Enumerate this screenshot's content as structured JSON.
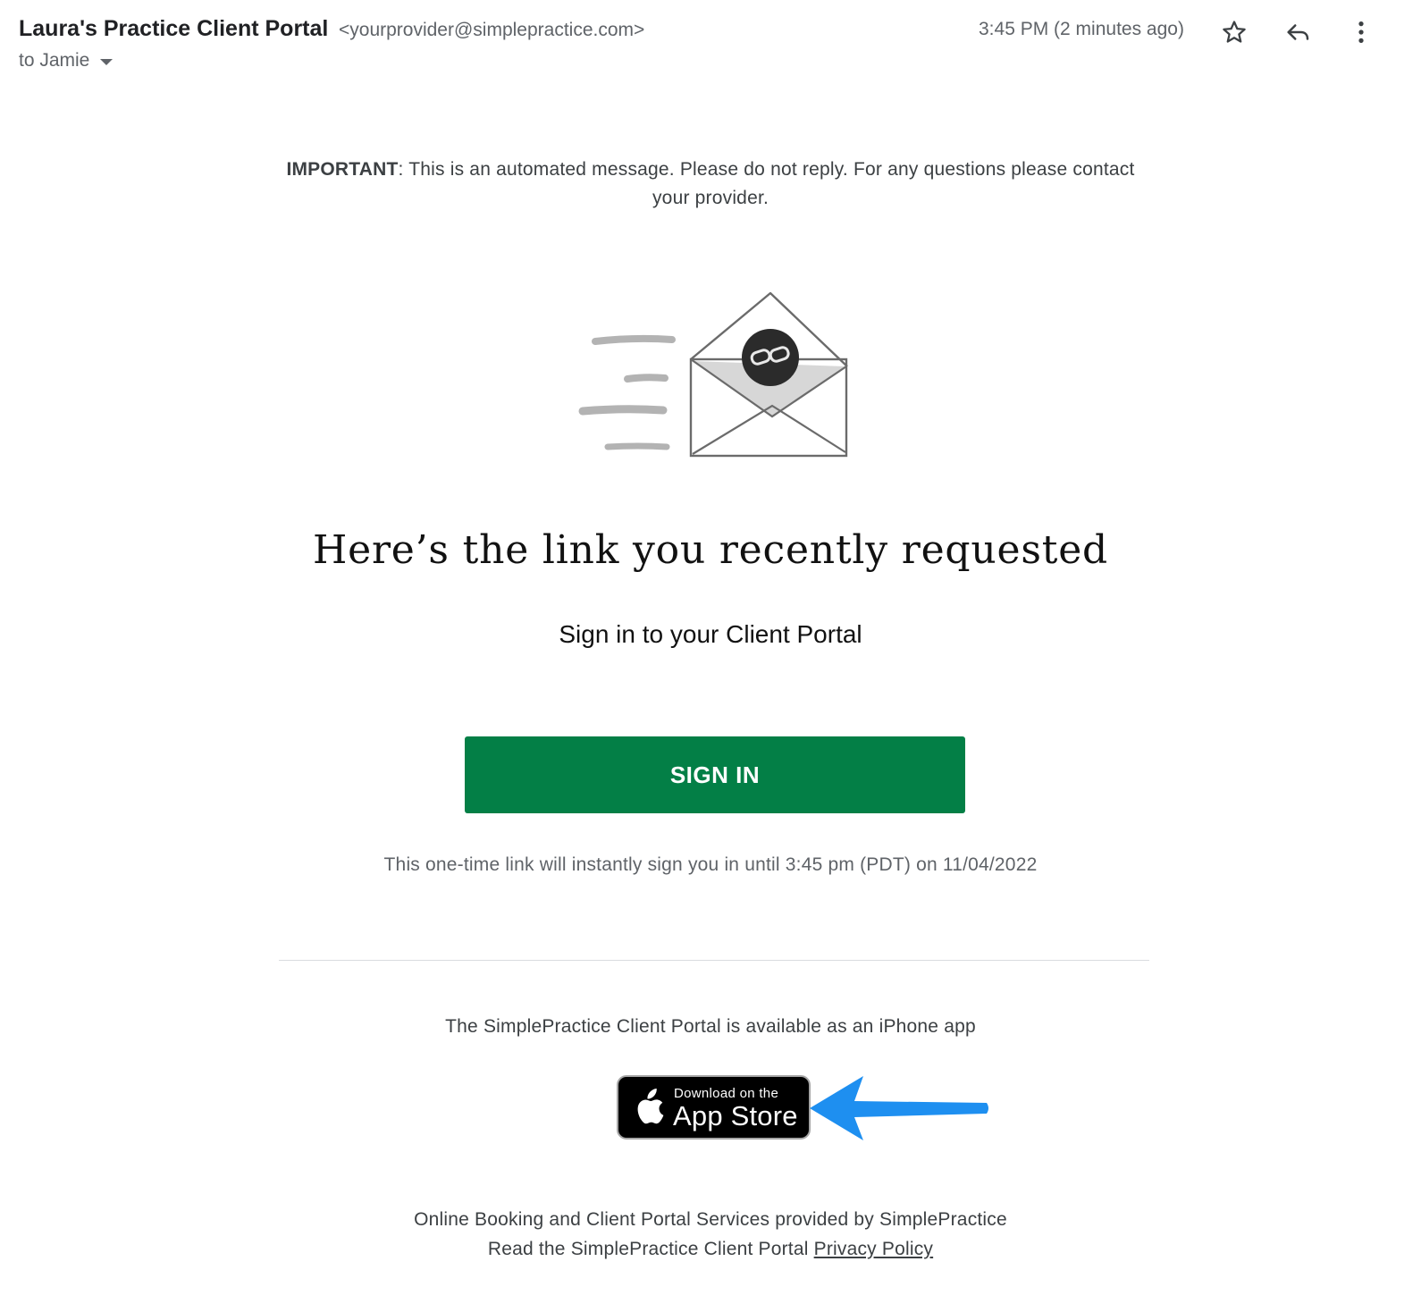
{
  "email": {
    "sender_name": "Laura's Practice Client Portal",
    "sender_email": "<yourprovider@simplepractice.com>",
    "recipient": "to Jamie",
    "timestamp": "3:45 PM (2 minutes ago)",
    "actions": [
      "star-icon",
      "reply-icon",
      "more-vert-icon"
    ]
  },
  "body": {
    "notice_bold": "IMPORTANT",
    "notice_text": ": This is an automated message. Please do not reply. For any questions please contact your provider.",
    "headline": "Here’s the link you recently requested",
    "subline": "Sign in to your Client Portal",
    "signin_label": "SIGN IN",
    "one_time_text": "This one-time link will instantly sign you in until 3:45 pm (PDT) on 11/04/2022",
    "iphone_text": "The SimplePractice Client Portal is available as an iPhone app",
    "appstore_small": "Download on the",
    "appstore_big": "App Store",
    "footer_line1": "Online Booking and Client Portal Services provided by SimplePractice",
    "footer_line2_prefix": "Read the SimplePractice Client Portal ",
    "privacy_link": "Privacy Policy"
  },
  "colors": {
    "signin_green": "#037f46",
    "annotation_arrow": "#1e8ff0"
  }
}
